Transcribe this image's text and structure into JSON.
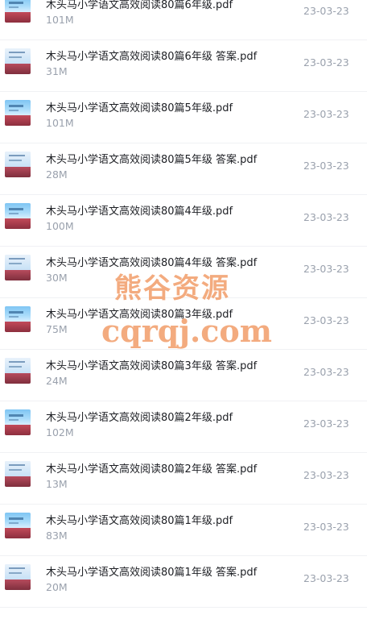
{
  "files": [
    {
      "name": "木头马小学语文高效阅读80篇6年级.pdf",
      "size": "101M",
      "date": "23-03-23",
      "thumb": "cover"
    },
    {
      "name": "木头马小学语文高效阅读80篇6年级 答案.pdf",
      "size": "31M",
      "date": "23-03-23",
      "thumb": "answer"
    },
    {
      "name": "木头马小学语文高效阅读80篇5年级.pdf",
      "size": "101M",
      "date": "23-03-23",
      "thumb": "cover"
    },
    {
      "name": "木头马小学语文高效阅读80篇5年级 答案.pdf",
      "size": "28M",
      "date": "23-03-23",
      "thumb": "answer"
    },
    {
      "name": "木头马小学语文高效阅读80篇4年级.pdf",
      "size": "100M",
      "date": "23-03-23",
      "thumb": "cover"
    },
    {
      "name": "木头马小学语文高效阅读80篇4年级 答案.pdf",
      "size": "30M",
      "date": "23-03-23",
      "thumb": "answer"
    },
    {
      "name": "木头马小学语文高效阅读80篇3年级.pdf",
      "size": "75M",
      "date": "23-03-23",
      "thumb": "cover"
    },
    {
      "name": "木头马小学语文高效阅读80篇3年级 答案.pdf",
      "size": "24M",
      "date": "23-03-23",
      "thumb": "answer"
    },
    {
      "name": "木头马小学语文高效阅读80篇2年级.pdf",
      "size": "102M",
      "date": "23-03-23",
      "thumb": "cover"
    },
    {
      "name": "木头马小学语文高效阅读80篇2年级 答案.pdf",
      "size": "13M",
      "date": "23-03-23",
      "thumb": "answer"
    },
    {
      "name": "木头马小学语文高效阅读80篇1年级.pdf",
      "size": "83M",
      "date": "23-03-23",
      "thumb": "cover"
    },
    {
      "name": "木头马小学语文高效阅读80篇1年级 答案.pdf",
      "size": "20M",
      "date": "23-03-23",
      "thumb": "answer"
    }
  ],
  "watermark": {
    "line1": "熊谷资源",
    "line2": "cqrqj.com",
    "color": "#f2a06e"
  },
  "colors": {
    "filename": "#1d1f24",
    "meta": "#9aa1ad",
    "divider": "#f0f1f4"
  }
}
